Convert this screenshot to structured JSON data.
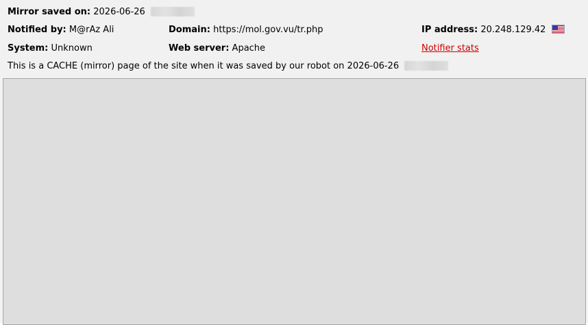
{
  "header": {
    "mirror_saved": {
      "label": "Mirror saved on:",
      "value": "2026-06-26"
    },
    "notified_by": {
      "label": "Notified by:",
      "value": "M@rAz Ali"
    },
    "domain": {
      "label": "Domain:",
      "value": "https://mol.gov.vu/tr.php"
    },
    "ip_address": {
      "label": "IP address:",
      "value": "20.248.129.42",
      "flag": "us-flag-icon"
    },
    "system": {
      "label": "System:",
      "value": "Unknown"
    },
    "web_server": {
      "label": "Web server:",
      "value": "Apache"
    },
    "notifier_stats_link": "Notifier stats",
    "cache_notice": "This is a CACHE (mirror) page of the site when it was saved by our robot on 2026-06-26"
  },
  "colors": {
    "link": "#cc0000",
    "header_bg": "#f1f1f1",
    "mirror_bg": "#dedede"
  }
}
